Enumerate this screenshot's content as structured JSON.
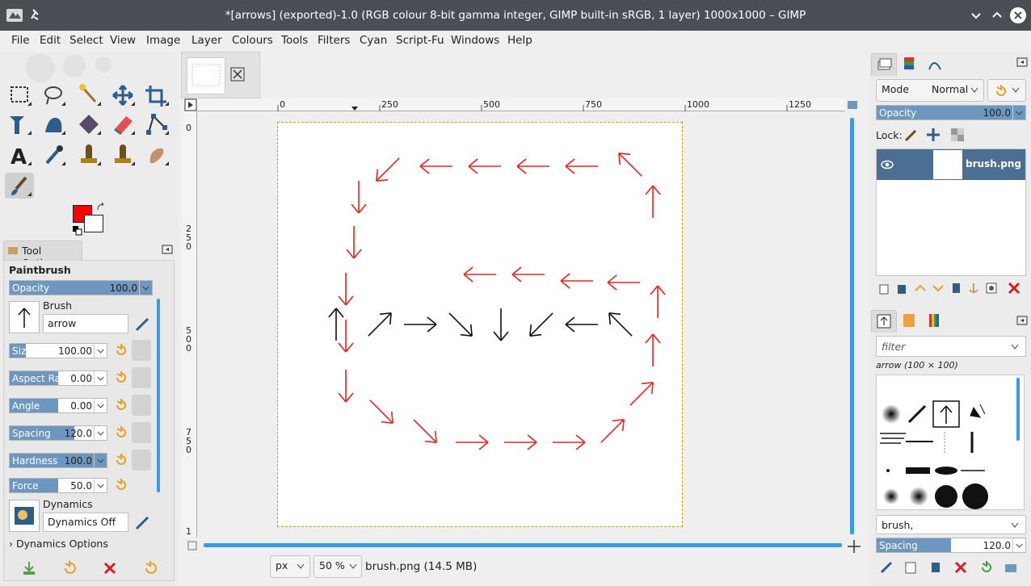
{
  "window": {
    "title": "*[arrows] (exported)-1.0 (RGB colour 8-bit gamma integer, GIMP built-in sRGB, 1 layer) 1000x1000 – GIMP"
  },
  "menu": [
    "File",
    "Edit",
    "Select",
    "View",
    "Image",
    "Layer",
    "Colours",
    "Tools",
    "Filters",
    "Cyan",
    "Script-Fu",
    "Windows",
    "Help"
  ],
  "colors": {
    "foreground": "#ff0000",
    "background": "#ffffff",
    "accent": "#3c9be0",
    "slider_fill": "#6e97c0",
    "layer_selected": "#4b6e93"
  },
  "toolbox": {
    "tools": [
      "rect-select-icon",
      "free-select-icon",
      "fuzzy-select-icon",
      "move-icon",
      "crop-icon",
      "unified-transform-icon",
      "warp-icon",
      "paint-select-icon",
      "eraser-icon",
      "paths-icon",
      "text-icon",
      "color-picker-icon",
      "clone-icon",
      "heal-icon",
      "smudge-icon",
      "paintbrush-icon"
    ]
  },
  "tool_options": {
    "tab_label": "Tool Options",
    "title": "Paintbrush",
    "opacity": {
      "label": "Opacity",
      "value": "100.0",
      "fraction": 1.0
    },
    "brush": {
      "label": "Brush",
      "name": "arrow"
    },
    "size": {
      "label": "Size",
      "value": "100.00",
      "fraction": 0.17
    },
    "aspect_ratio": {
      "label": "Aspect Ratio",
      "value": "0.00",
      "fraction": 0.5
    },
    "angle": {
      "label": "Angle",
      "value": "0.00",
      "fraction": 0.5
    },
    "spacing": {
      "label": "Spacing",
      "value": "120.0",
      "fraction": 0.67
    },
    "hardness": {
      "label": "Hardness",
      "value": "100.0",
      "fraction": 1.0
    },
    "force": {
      "label": "Force",
      "value": "50.0",
      "fraction": 0.5
    },
    "dynamics": {
      "label": "Dynamics",
      "name": "Dynamics Off"
    },
    "dynamics_options": "Dynamics Options"
  },
  "canvas": {
    "ruler_h": [
      "0",
      "250",
      "500",
      "750",
      "1000",
      "1250"
    ],
    "ruler_v": [
      "0",
      "250",
      "500",
      "750",
      "1"
    ],
    "unit": "px",
    "zoom": "50 %",
    "status": "brush.png (14.5 MB)"
  },
  "layers": {
    "mode_label": "Mode",
    "mode_value": "Normal",
    "opacity_label": "Opacity",
    "opacity_value": "100.0",
    "lock_label": "Lock:",
    "items": [
      {
        "name": "brush.png"
      }
    ]
  },
  "brushes": {
    "filter_placeholder": "filter",
    "selected": "arrow (100 × 100)",
    "tag_value": "brush,",
    "spacing_label": "Spacing",
    "spacing_value": "120.0",
    "spacing_fraction": 0.5
  }
}
